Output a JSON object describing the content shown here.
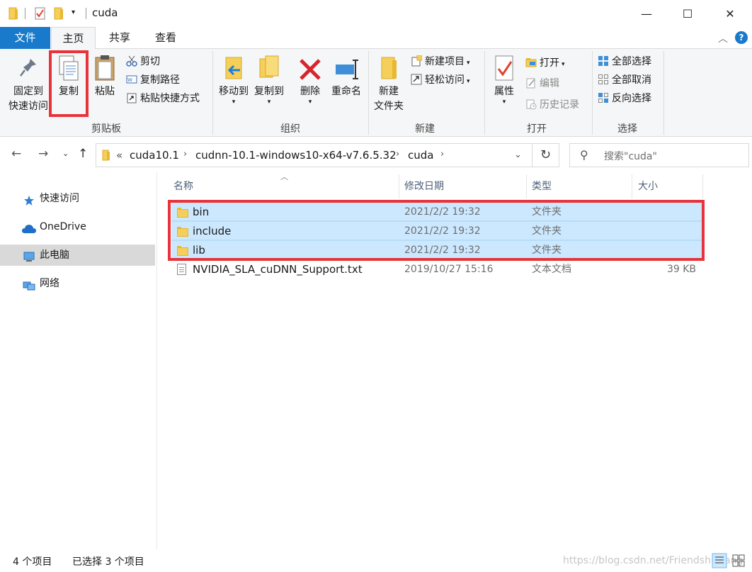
{
  "window": {
    "title": "cuda",
    "minimize_glyph": "—",
    "maximize_glyph": "☐",
    "close_glyph": "✕"
  },
  "tabs": {
    "file": "文件",
    "home": "主页",
    "share": "共享",
    "view": "查看"
  },
  "help": {
    "collapse_glyph": "︿",
    "help_glyph": "?"
  },
  "ribbon": {
    "clipboard": {
      "label": "剪贴板",
      "pin_line1": "固定到",
      "pin_line2": "快速访问",
      "copy": "复制",
      "paste": "粘贴",
      "cut": "剪切",
      "copy_path": "复制路径",
      "paste_shortcut": "粘贴快捷方式"
    },
    "organize": {
      "label": "组织",
      "move_to": "移动到",
      "copy_to": "复制到",
      "delete": "删除",
      "rename": "重命名"
    },
    "new": {
      "label": "新建",
      "new_folder_line1": "新建",
      "new_folder_line2": "文件夹",
      "new_item": "新建项目",
      "easy_access": "轻松访问"
    },
    "open": {
      "label": "打开",
      "properties": "属性",
      "open": "打开",
      "edit": "编辑",
      "history": "历史记录"
    },
    "select": {
      "label": "选择",
      "select_all": "全部选择",
      "select_none": "全部取消",
      "invert": "反向选择"
    }
  },
  "address": {
    "overflow": "«",
    "crumbs": [
      "cuda10.1",
      "cudnn-10.1-windows10-x64-v7.6.5.32",
      "cuda"
    ],
    "search_placeholder": "搜索\"cuda\""
  },
  "nav": {
    "items": [
      {
        "label": "快速访问",
        "icon": "star-icon"
      },
      {
        "label": "OneDrive",
        "icon": "cloud-icon"
      },
      {
        "label": "此电脑",
        "icon": "computer-icon"
      },
      {
        "label": "网络",
        "icon": "network-icon"
      }
    ]
  },
  "columns": {
    "name": "名称",
    "date": "修改日期",
    "type": "类型",
    "size": "大小"
  },
  "files": [
    {
      "name": "bin",
      "date": "2021/2/2 19:32",
      "type": "文件夹",
      "size": "",
      "selected": true
    },
    {
      "name": "include",
      "date": "2021/2/2 19:32",
      "type": "文件夹",
      "size": "",
      "selected": true
    },
    {
      "name": "lib",
      "date": "2021/2/2 19:32",
      "type": "文件夹",
      "size": "",
      "selected": true
    },
    {
      "name": "NVIDIA_SLA_cuDNN_Support.txt",
      "date": "2019/10/27 15:16",
      "type": "文本文档",
      "size": "39 KB",
      "selected": false
    }
  ],
  "status": {
    "item_count": "4 个项目",
    "selected_count": "已选择 3 个项目",
    "watermark": "https://blog.csdn.net/FriendshipTang"
  },
  "colors": {
    "accent": "#1979ca",
    "selection": "#cce8ff",
    "highlight_frame": "#e8333a"
  }
}
